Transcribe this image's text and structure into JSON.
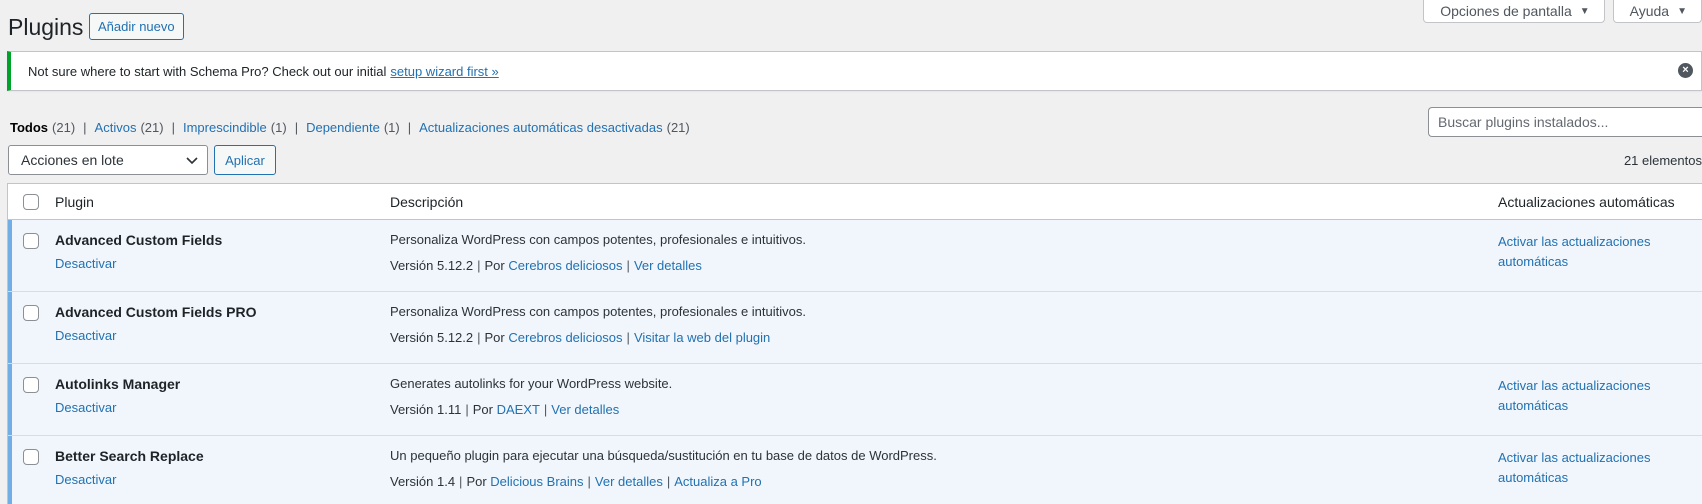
{
  "header": {
    "title": "Plugins",
    "add_new": "Añadir nuevo",
    "screen_options": "Opciones de pantalla",
    "help": "Ayuda"
  },
  "notice": {
    "text": "Not sure where to start with Schema Pro? Check out our initial",
    "link": "setup wizard first »"
  },
  "filters": [
    {
      "label": "Todos",
      "count": "(21)",
      "current": true
    },
    {
      "label": "Activos",
      "count": "(21)"
    },
    {
      "label": "Imprescindible",
      "count": "(1)"
    },
    {
      "label": "Dependiente",
      "count": "(1)"
    },
    {
      "label": "Actualizaciones automáticas desactivadas",
      "count": "(21)"
    }
  ],
  "search": {
    "placeholder": "Buscar plugins instalados..."
  },
  "bulk": {
    "selected": "Acciones en lote",
    "apply": "Aplicar",
    "item_count": "21 elementos"
  },
  "table": {
    "columns": {
      "plugin": "Plugin",
      "description": "Descripción",
      "auto_updates": "Actualizaciones automáticas"
    },
    "rows": [
      {
        "name": "Advanced Custom Fields",
        "action": "Desactivar",
        "description": "Personaliza WordPress con campos potentes, profesionales e intuitivos.",
        "version": "Versión 5.12.2",
        "by": "Por",
        "author": "Cerebros deliciosos",
        "links": [
          "Ver detalles"
        ],
        "auto_line1": "Activar las actualizaciones",
        "auto_line2": "automáticas"
      },
      {
        "name": "Advanced Custom Fields PRO",
        "action": "Desactivar",
        "description": "Personaliza WordPress con campos potentes, profesionales e intuitivos.",
        "version": "Versión 5.12.2",
        "by": "Por",
        "author": "Cerebros deliciosos",
        "links": [
          "Visitar la web del plugin"
        ],
        "auto_line1": "",
        "auto_line2": ""
      },
      {
        "name": "Autolinks Manager",
        "action": "Desactivar",
        "description": "Generates autolinks for your WordPress website.",
        "version": "Versión 1.11",
        "by": "Por",
        "author": "DAEXT",
        "links": [
          "Ver detalles"
        ],
        "auto_line1": "Activar las actualizaciones",
        "auto_line2": "automáticas"
      },
      {
        "name": "Better Search Replace",
        "action": "Desactivar",
        "description": "Un pequeño plugin para ejecutar una búsqueda/sustitución en tu base de datos de WordPress.",
        "version": "Versión 1.4",
        "by": "Por",
        "author": "Delicious Brains",
        "links": [
          "Ver detalles",
          "Actualiza a Pro"
        ],
        "auto_line1": "Activar las actualizaciones",
        "auto_line2": "automáticas"
      }
    ]
  },
  "colors": {
    "accent": "#2271b1",
    "active_row_bg": "#f0f6fc",
    "active_row_border": "#72aee6",
    "notice_success": "#00a32a"
  }
}
